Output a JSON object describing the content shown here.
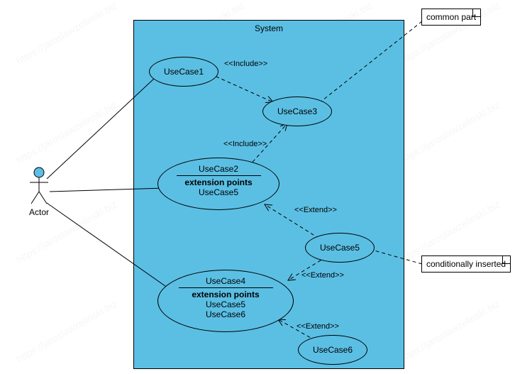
{
  "diagram": {
    "type": "uml-use-case",
    "system_name": "System",
    "actor": {
      "name": "Actor"
    },
    "usecases": {
      "uc1": {
        "name": "UseCase1"
      },
      "uc2": {
        "name": "UseCase2",
        "extension_points_label": "extension points",
        "extension_points": [
          "UseCase5"
        ]
      },
      "uc3": {
        "name": "UseCase3"
      },
      "uc4": {
        "name": "UseCase4",
        "extension_points_label": "extension points",
        "extension_points": [
          "UseCase5",
          "UseCase6"
        ]
      },
      "uc5": {
        "name": "UseCase5"
      },
      "uc6": {
        "name": "UseCase6"
      }
    },
    "notes": {
      "common": "common part",
      "cond": "conditionally inserted"
    },
    "stereotypes": {
      "include": "<<Include>>",
      "extend": "<<Extend>>"
    },
    "watermark": "https://jaroslawzelinski.biz",
    "relationships": [
      {
        "from": "Actor",
        "to": "UseCase1",
        "type": "association"
      },
      {
        "from": "Actor",
        "to": "UseCase2",
        "type": "association"
      },
      {
        "from": "Actor",
        "to": "UseCase4",
        "type": "association"
      },
      {
        "from": "UseCase1",
        "to": "UseCase3",
        "type": "include"
      },
      {
        "from": "UseCase2",
        "to": "UseCase3",
        "type": "include"
      },
      {
        "from": "UseCase5",
        "to": "UseCase2",
        "type": "extend"
      },
      {
        "from": "UseCase5",
        "to": "UseCase4",
        "type": "extend"
      },
      {
        "from": "UseCase6",
        "to": "UseCase4",
        "type": "extend"
      },
      {
        "from": "note:common part",
        "to": "UseCase3",
        "type": "anchor"
      },
      {
        "from": "note:conditionally inserted",
        "to": "UseCase5",
        "type": "anchor"
      }
    ]
  }
}
